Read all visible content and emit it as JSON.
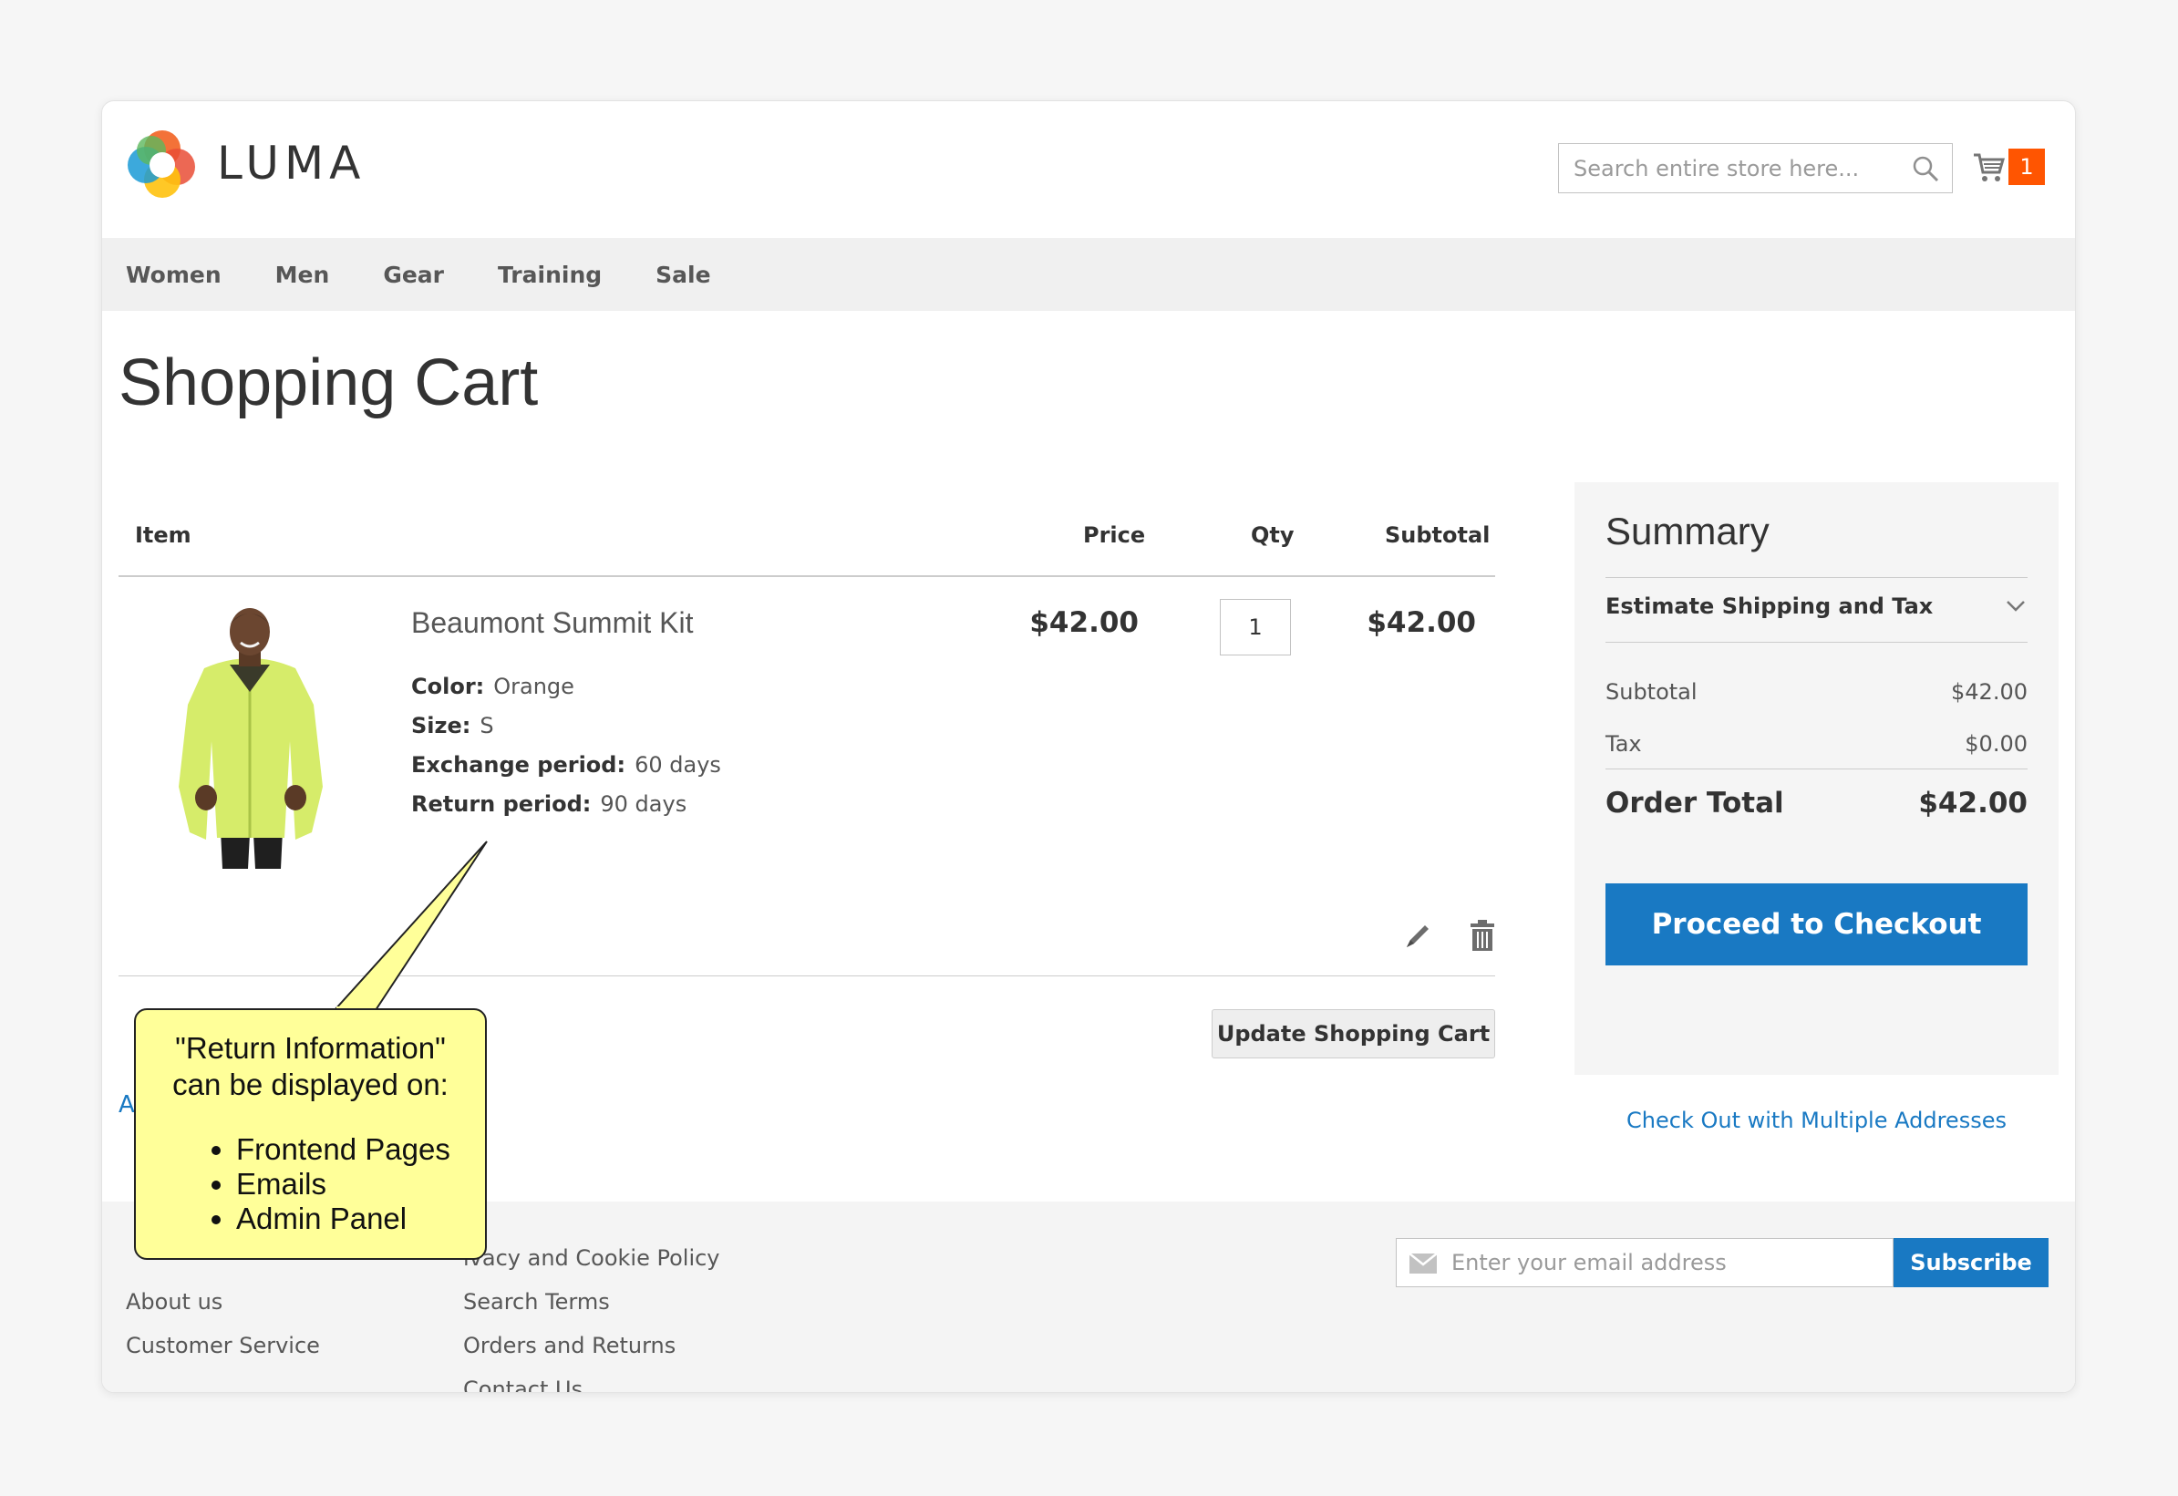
{
  "brand": {
    "name": "LUMA"
  },
  "header": {
    "search_placeholder": "Search entire store here...",
    "cart_count": "1"
  },
  "nav": {
    "items": [
      "Women",
      "Men",
      "Gear",
      "Training",
      "Sale"
    ]
  },
  "page": {
    "title": "Shopping Cart"
  },
  "cart": {
    "columns": {
      "item": "Item",
      "price": "Price",
      "qty": "Qty",
      "subtotal": "Subtotal"
    },
    "items": [
      {
        "name": "Beaumont Summit Kit",
        "price": "$42.00",
        "qty": "1",
        "subtotal": "$42.00",
        "options": [
          {
            "label": "Color:",
            "value": "Orange"
          },
          {
            "label": "Size:",
            "value": "S"
          },
          {
            "label": "Exchange period:",
            "value": "60 days"
          },
          {
            "label": "Return period:",
            "value": "90 days"
          }
        ]
      }
    ],
    "update_label": "Update Shopping Cart",
    "action_link_partial": "A"
  },
  "summary": {
    "title": "Summary",
    "estimate_label": "Estimate Shipping and Tax",
    "subtotal_label": "Subtotal",
    "subtotal_value": "$42.00",
    "tax_label": "Tax",
    "tax_value": "$0.00",
    "order_total_label": "Order Total",
    "order_total_value": "$42.00",
    "checkout_label": "Proceed to Checkout",
    "multi_address_label": "Check Out with Multiple Addresses"
  },
  "footer": {
    "col1": [
      "About us",
      "Customer Service"
    ],
    "col2": [
      "ivacy and Cookie Policy",
      "Search Terms",
      "Orders and Returns",
      "Contact Us"
    ],
    "newsletter_placeholder": "Enter your email address",
    "subscribe_label": "Subscribe"
  },
  "callout": {
    "line1": "\"Return Information\"",
    "line2": "can be displayed on:",
    "items": [
      "Frontend Pages",
      "Emails",
      "Admin Panel"
    ]
  },
  "colors": {
    "accent": "#1979c3",
    "cart_badge": "#ff5501",
    "callout_fill": "#ffff99",
    "product_jacket": "#d6ec6a"
  },
  "icons": [
    "search-icon",
    "cart-icon",
    "edit-icon",
    "trash-icon",
    "chevron-down-icon",
    "mail-icon"
  ]
}
